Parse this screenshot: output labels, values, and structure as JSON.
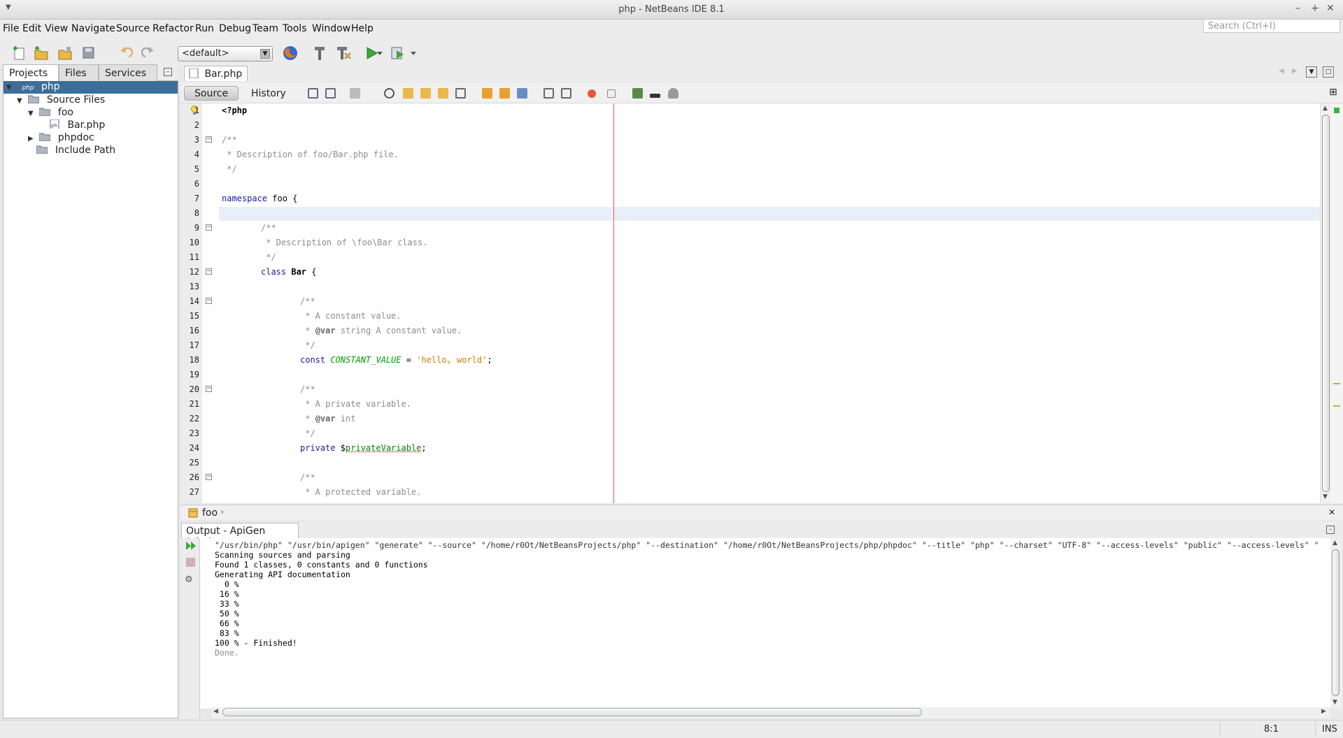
{
  "window": {
    "title": "php - NetBeans IDE 8.1"
  },
  "menu": [
    "File",
    "Edit",
    "View",
    "Navigate",
    "Source",
    "Refactor",
    "Run",
    "Debug",
    "Team",
    "Tools",
    "Window",
    "Help"
  ],
  "search": {
    "placeholder": "Search (Ctrl+I)"
  },
  "toolbar": {
    "config": "<default>"
  },
  "left_tabs": [
    "Projects",
    "Files",
    "Services"
  ],
  "tree": [
    {
      "label": "php",
      "icon": "php",
      "level": 0
    },
    {
      "label": "Source Files",
      "level": 1
    },
    {
      "label": "foo",
      "level": 2
    },
    {
      "label": "Bar.php",
      "level": 3
    },
    {
      "label": "phpdoc",
      "level": 2
    },
    {
      "label": "Include Path",
      "level": 1
    }
  ],
  "tree_php_icon": "php",
  "editor": {
    "tab": "Bar.php",
    "modes": [
      "Source",
      "History"
    ],
    "breadcrumb": "foo"
  },
  "code": {
    "l1": "<?php",
    "l3": "/**",
    "l4": " * Description of foo/Bar.php file.",
    "l5": " */",
    "l7_kw": "namespace",
    "l7_rest": " foo {",
    "l9": "/**",
    "l10": " * Description of \\foo\\Bar class.",
    "l11": " */",
    "l12_kw": "class",
    "l12_name": "Bar",
    "l12_rest": " {",
    "l14": "/**",
    "l15": " * A constant value.",
    "l16_pre": " * ",
    "l16_tag": "@var",
    "l16_rest": " string A constant value.",
    "l17": " */",
    "l18_kw": "const",
    "l18_const": "CONSTANT_VALUE",
    "l18_eq": " = ",
    "l18_str": "'hello, world'",
    "l18_end": ";",
    "l20": "/**",
    "l21": " * A private variable.",
    "l22_pre": " * ",
    "l22_tag": "@var",
    "l22_rest": " int",
    "l23": " */",
    "l24_kw": "private",
    "l24_dollar": " $",
    "l24_var": "privateVariable",
    "l24_end": ";",
    "l26": "/**",
    "l27": " * A protected variable."
  },
  "line_numbers": [
    "1",
    "2",
    "3",
    "4",
    "5",
    "6",
    "7",
    "8",
    "9",
    "10",
    "11",
    "12",
    "13",
    "14",
    "15",
    "16",
    "17",
    "18",
    "19",
    "20",
    "21",
    "22",
    "23",
    "24",
    "25",
    "26",
    "27"
  ],
  "output": {
    "tab": "Output - ApiGen (php)",
    "lines": [
      "\"/usr/bin/php\" \"/usr/bin/apigen\" \"generate\" \"--source\" \"/home/r0Ot/NetBeansProjects/php\" \"--destination\" \"/home/r0Ot/NetBeansProjects/php/phpdoc\" \"--title\" \"php\" \"--charset\" \"UTF-8\" \"--access-levels\" \"public\" \"--access-levels\" \"",
      "Scanning sources and parsing",
      "Found 1 classes, 0 constants and 0 functions",
      "Generating API documentation",
      "  0 %",
      " 16 %",
      " 33 %",
      " 50 %",
      " 66 %",
      " 83 %",
      "100 % - Finished!",
      "Done."
    ]
  },
  "status": {
    "position": "8:1",
    "mode": "INS"
  },
  "colors": {
    "keyword": "#1a1aa6",
    "comment": "#8c8c8c",
    "string": "#ce7b00",
    "constant": "#009900",
    "selection": "#3c6e99"
  }
}
